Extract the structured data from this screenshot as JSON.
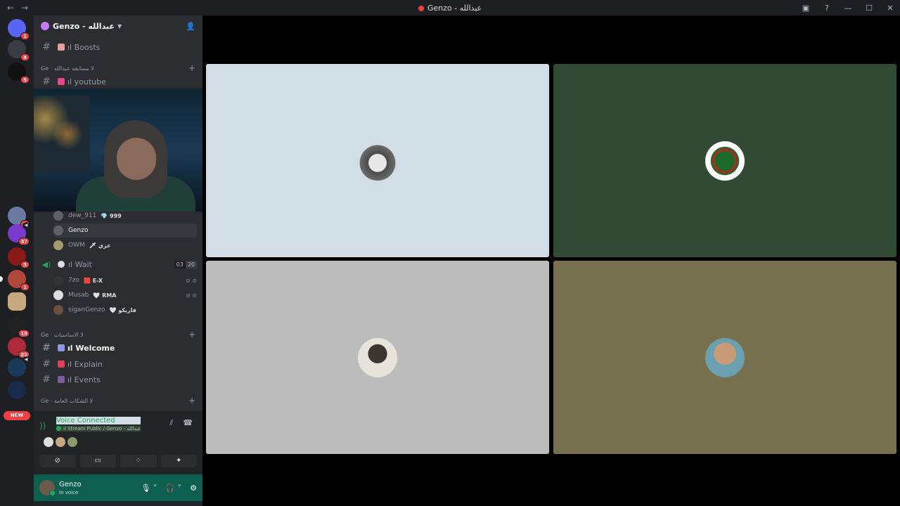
{
  "window": {
    "title": "Genzo - عبدالله"
  },
  "servers": [
    {
      "badge": "1"
    },
    {
      "badge": "4"
    },
    {
      "badge": "5"
    },
    {
      "badge": "2"
    },
    {
      "badge": "37"
    },
    {
      "badge": "3"
    },
    {
      "badge": "1"
    },
    {
      "badge": ""
    },
    {
      "badge": "15"
    },
    {
      "badge": "22"
    },
    {
      "badge": ""
    }
  ],
  "new_label": "NEW",
  "guild": {
    "name": "Genzo - عبدالله"
  },
  "channels": {
    "boosts": "ıl Boosts",
    "cat1": "Ge · ﻻ مسابقة عبدالله",
    "youtube": "ıl youtube",
    "cat2": "Ge · ﻻ الاساسيات",
    "welcome": "ıl Welcome",
    "explain": "ıl Explain",
    "events": "ıl Events",
    "cat3": "Ge · ﻻ الشكات العامة"
  },
  "members": [
    {
      "name": "dew_911",
      "tag": "💎 999"
    },
    {
      "name": "Genzo",
      "tag": ""
    },
    {
      "name": "OWM",
      "tag": "🗡 عزي"
    }
  ],
  "voice_channel": {
    "name": "ıl Wait",
    "count_a": "03",
    "count_b": "20"
  },
  "voice_members": [
    {
      "name": "7zo",
      "tag": "🟥 E-X"
    },
    {
      "name": "Musab",
      "tag": "🤍 RMA"
    },
    {
      "name": "siganGenzo",
      "tag": "🤍 فاريكو"
    }
  ],
  "voice_status": {
    "title": "Voice Connected",
    "subtitle": "ıl Stream Public / Genzo - عبدالله"
  },
  "user": {
    "name": "Genzo",
    "status": "In voice"
  }
}
